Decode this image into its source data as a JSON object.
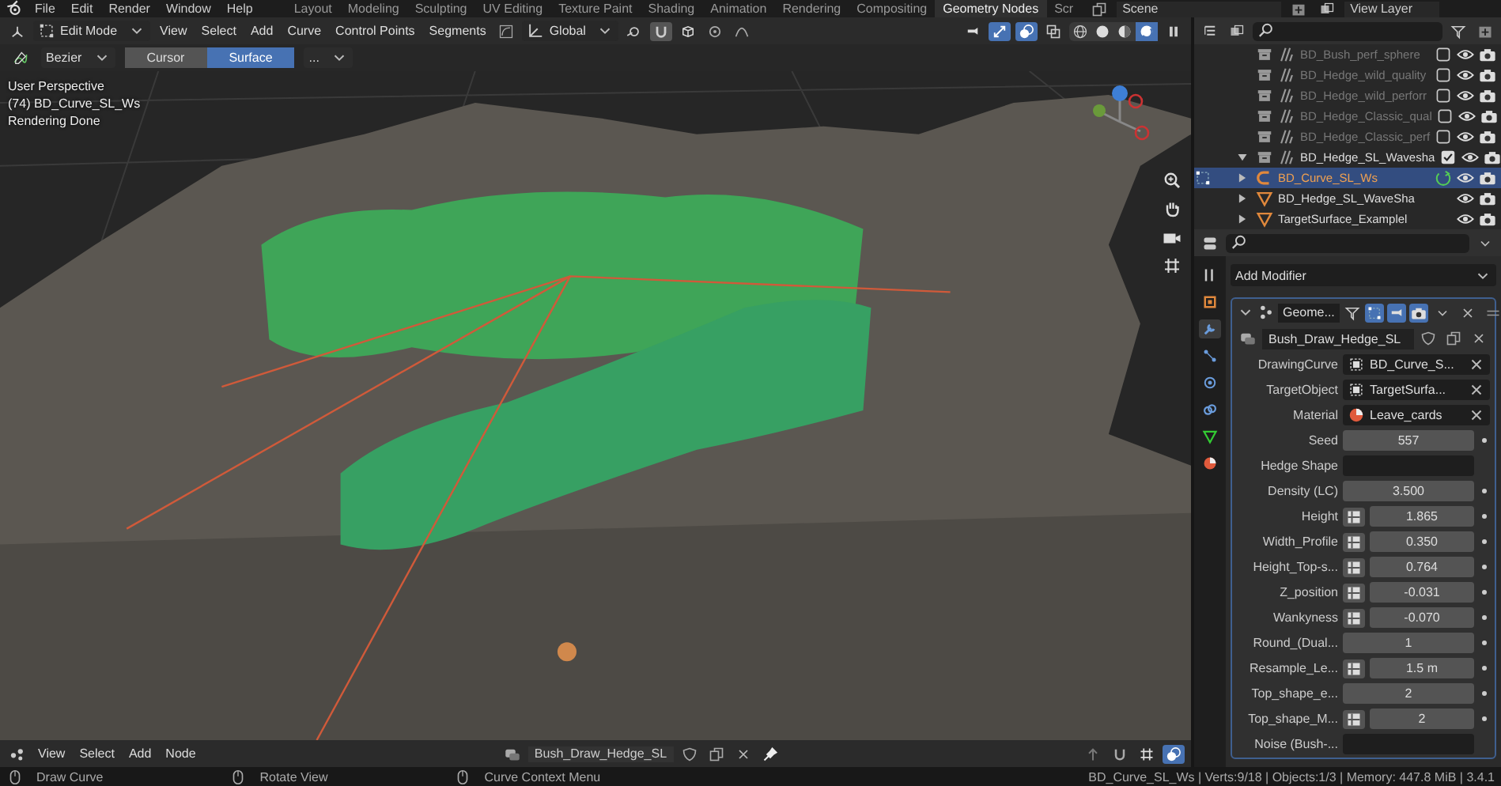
{
  "top_bar": {
    "menus": [
      "File",
      "Edit",
      "Render",
      "Window",
      "Help"
    ],
    "workspaces": [
      {
        "label": "Layout",
        "selected": false
      },
      {
        "label": "Modeling",
        "selected": false
      },
      {
        "label": "Sculpting",
        "selected": false
      },
      {
        "label": "UV Editing",
        "selected": false
      },
      {
        "label": "Texture Paint",
        "selected": false
      },
      {
        "label": "Shading",
        "selected": false
      },
      {
        "label": "Animation",
        "selected": false
      },
      {
        "label": "Rendering",
        "selected": false
      },
      {
        "label": "Compositing",
        "selected": false
      },
      {
        "label": "Geometry Nodes",
        "selected": true
      },
      {
        "label": "Scr",
        "selected": false
      }
    ],
    "scene": "Scene",
    "view_layer": "View Layer"
  },
  "viewport": {
    "mode": "Edit Mode",
    "menus": [
      "View",
      "Select",
      "Add",
      "Curve",
      "Control Points",
      "Segments"
    ],
    "orientation": "Global",
    "curve_type": "Bezier",
    "depth_options": [
      {
        "label": "Cursor",
        "selected": false
      },
      {
        "label": "Surface",
        "selected": true
      }
    ],
    "more": "...",
    "info": [
      "User Perspective",
      "(74) BD_Curve_SL_Ws",
      "Rendering Done"
    ],
    "gizmos_on": true,
    "overlays_on": true,
    "shading_modes": [
      {
        "kind": "wireframe",
        "selected": false
      },
      {
        "kind": "solid",
        "selected": false
      },
      {
        "kind": "material",
        "selected": false
      },
      {
        "kind": "rendered",
        "selected": true
      }
    ]
  },
  "outliner": {
    "rows": [
      {
        "kind": "collection",
        "name": "BD_Bush_perf_sphere",
        "checked": false,
        "selected": false
      },
      {
        "kind": "collection",
        "name": "BD_Hedge_wild_quality",
        "checked": false,
        "selected": false
      },
      {
        "kind": "collection",
        "name": "BD_Hedge_wild_perforr",
        "checked": false,
        "selected": false
      },
      {
        "kind": "collection",
        "name": "BD_Hedge_Classic_qual",
        "checked": false,
        "selected": false
      },
      {
        "kind": "collection",
        "name": "BD_Hedge_Classic_perf",
        "checked": false,
        "selected": false
      },
      {
        "kind": "collection",
        "name": "BD_Hedge_SL_Wavesha",
        "checked": true,
        "selected": false,
        "expanded": true,
        "children": [
          {
            "kind": "curve",
            "name": "BD_Curve_SL_Ws",
            "selected": true
          },
          {
            "kind": "mesh",
            "name": "BD_Hedge_SL_WaveSha",
            "selected": false
          },
          {
            "kind": "mesh",
            "name": "TargetSurface_Examplel",
            "selected": false
          }
        ]
      }
    ]
  },
  "properties": {
    "tabs": [
      {
        "kind": "object",
        "selected": false
      },
      {
        "kind": "modifier",
        "selected": true
      },
      {
        "kind": "particles",
        "selected": false
      },
      {
        "kind": "physics",
        "selected": false
      },
      {
        "kind": "constraints",
        "selected": false
      },
      {
        "kind": "data",
        "selected": false
      },
      {
        "kind": "material",
        "selected": false
      }
    ],
    "add_modifier": "Add Modifier",
    "modifier": {
      "name": "Geome...",
      "edit_mode": true,
      "viewport": true,
      "render": true,
      "node_group": "Bush_Draw_Hedge_SL",
      "inputs": [
        {
          "kind": "object",
          "label": "DrawingCurve",
          "value": "BD_Curve_S..."
        },
        {
          "kind": "object",
          "label": "TargetObject",
          "value": "TargetSurfa..."
        },
        {
          "kind": "material",
          "label": "Material",
          "value": "Leave_cards"
        },
        {
          "kind": "number",
          "label": "Seed",
          "value": "557",
          "attribute": false
        },
        {
          "kind": "empty",
          "label": "Hedge Shape"
        },
        {
          "kind": "number",
          "label": "Density (LC)",
          "value": "3.500",
          "attribute": false
        },
        {
          "kind": "number",
          "label": "Height",
          "value": "1.865",
          "attribute": true
        },
        {
          "kind": "number",
          "label": "Width_Profile",
          "value": "0.350",
          "attribute": true
        },
        {
          "kind": "number",
          "label": "Height_Top-s...",
          "value": "0.764",
          "attribute": true
        },
        {
          "kind": "number",
          "label": "Z_position",
          "value": "-0.031",
          "attribute": true
        },
        {
          "kind": "number",
          "label": "Wankyness",
          "value": "-0.070",
          "attribute": true
        },
        {
          "kind": "number",
          "label": "Round_(Dual...",
          "value": "1",
          "attribute": false
        },
        {
          "kind": "number",
          "label": "Resample_Le...",
          "value": "1.5 m",
          "attribute": true
        },
        {
          "kind": "number",
          "label": "Top_shape_e...",
          "value": "2",
          "attribute": false
        },
        {
          "kind": "number",
          "label": "Top_shape_M...",
          "value": "2",
          "attribute": true
        },
        {
          "kind": "empty",
          "label": "Noise (Bush-..."
        }
      ]
    }
  },
  "node_editor": {
    "menus": [
      "View",
      "Select",
      "Add",
      "Node"
    ],
    "node_group": "Bush_Draw_Hedge_SL"
  },
  "status_bar": {
    "hints": [
      "Draw Curve",
      "Rotate View",
      "Curve Context Menu"
    ],
    "info": "BD_Curve_SL_Ws | Verts:9/18 | Objects:1/3 | Memory: 447.8 MiB | 3.4.1"
  }
}
